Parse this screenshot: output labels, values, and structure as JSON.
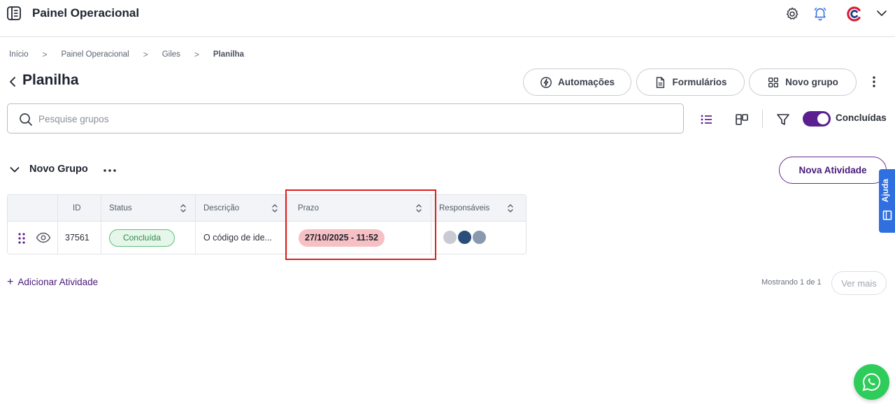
{
  "header": {
    "app_title": "Painel Operacional",
    "icons": [
      "sidebar-toggle-icon",
      "gear-icon",
      "bell-icon",
      "brand-logo-icon",
      "chevron-down-icon"
    ]
  },
  "breadcrumb": {
    "items": [
      "Início",
      "Painel Operacional",
      "Giles"
    ],
    "current": "Planilha",
    "separator": ">"
  },
  "page": {
    "title": "Planilha"
  },
  "actions": {
    "automations_label": "Automações",
    "forms_label": "Formulários",
    "new_group_label": "Novo grupo"
  },
  "search": {
    "placeholder": "Pesquise grupos",
    "value": ""
  },
  "view": {
    "completed_toggle_label": "Concluídas",
    "completed_toggle_on": true
  },
  "group": {
    "name": "Novo Grupo",
    "new_activity_label": "Nova Atividade"
  },
  "help": {
    "label": "Ajuda"
  },
  "table": {
    "columns": [
      "ID",
      "Status",
      "Descrição",
      "Prazo",
      "Responsáveis"
    ],
    "rows": [
      {
        "id": "37561",
        "status": "Concluída",
        "description": "O código de ide...",
        "deadline": "27/10/2025 - 11:52",
        "assignees_count": 3
      }
    ]
  },
  "footer": {
    "add_activity_label": "Adicionar Atividade",
    "add_symbol": "+",
    "showing_label": "Mostrando 1 de 1",
    "see_more_label": "Ver mais"
  },
  "colors": {
    "accent_purple": "#5b1f8f",
    "status_green": "#2e8a4a",
    "deadline_red_bg": "#f6c0c4",
    "highlight_red": "#e01b1b",
    "help_blue": "#2f6fe0",
    "whatsapp_green": "#2ecc5a"
  }
}
